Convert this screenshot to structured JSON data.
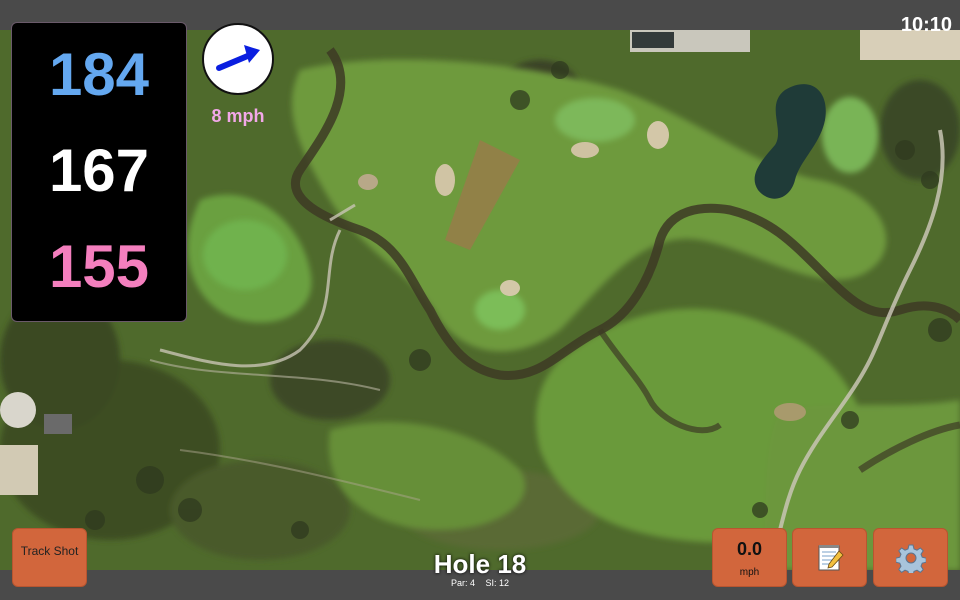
{
  "status_bar": {
    "time": "10:10"
  },
  "distances": {
    "back": "184",
    "middle": "167",
    "front": "155"
  },
  "wind": {
    "speed": "8 mph",
    "direction_icon": "arrow-northeast-icon"
  },
  "hole": {
    "title": "Hole 18",
    "par_label": "Par: 4",
    "si_label": "SI: 12"
  },
  "buttons": {
    "track_shot": "Track Shot",
    "speed_value": "0.0",
    "speed_unit": "mph",
    "notes_icon": "notepad-icon",
    "settings_icon": "gear-icon"
  },
  "colors": {
    "back_distance": "#64a8f0",
    "middle_distance": "#ffffff",
    "front_distance": "#f47fbe",
    "button": "#d2663c",
    "wind_text": "#f2a8e8"
  }
}
